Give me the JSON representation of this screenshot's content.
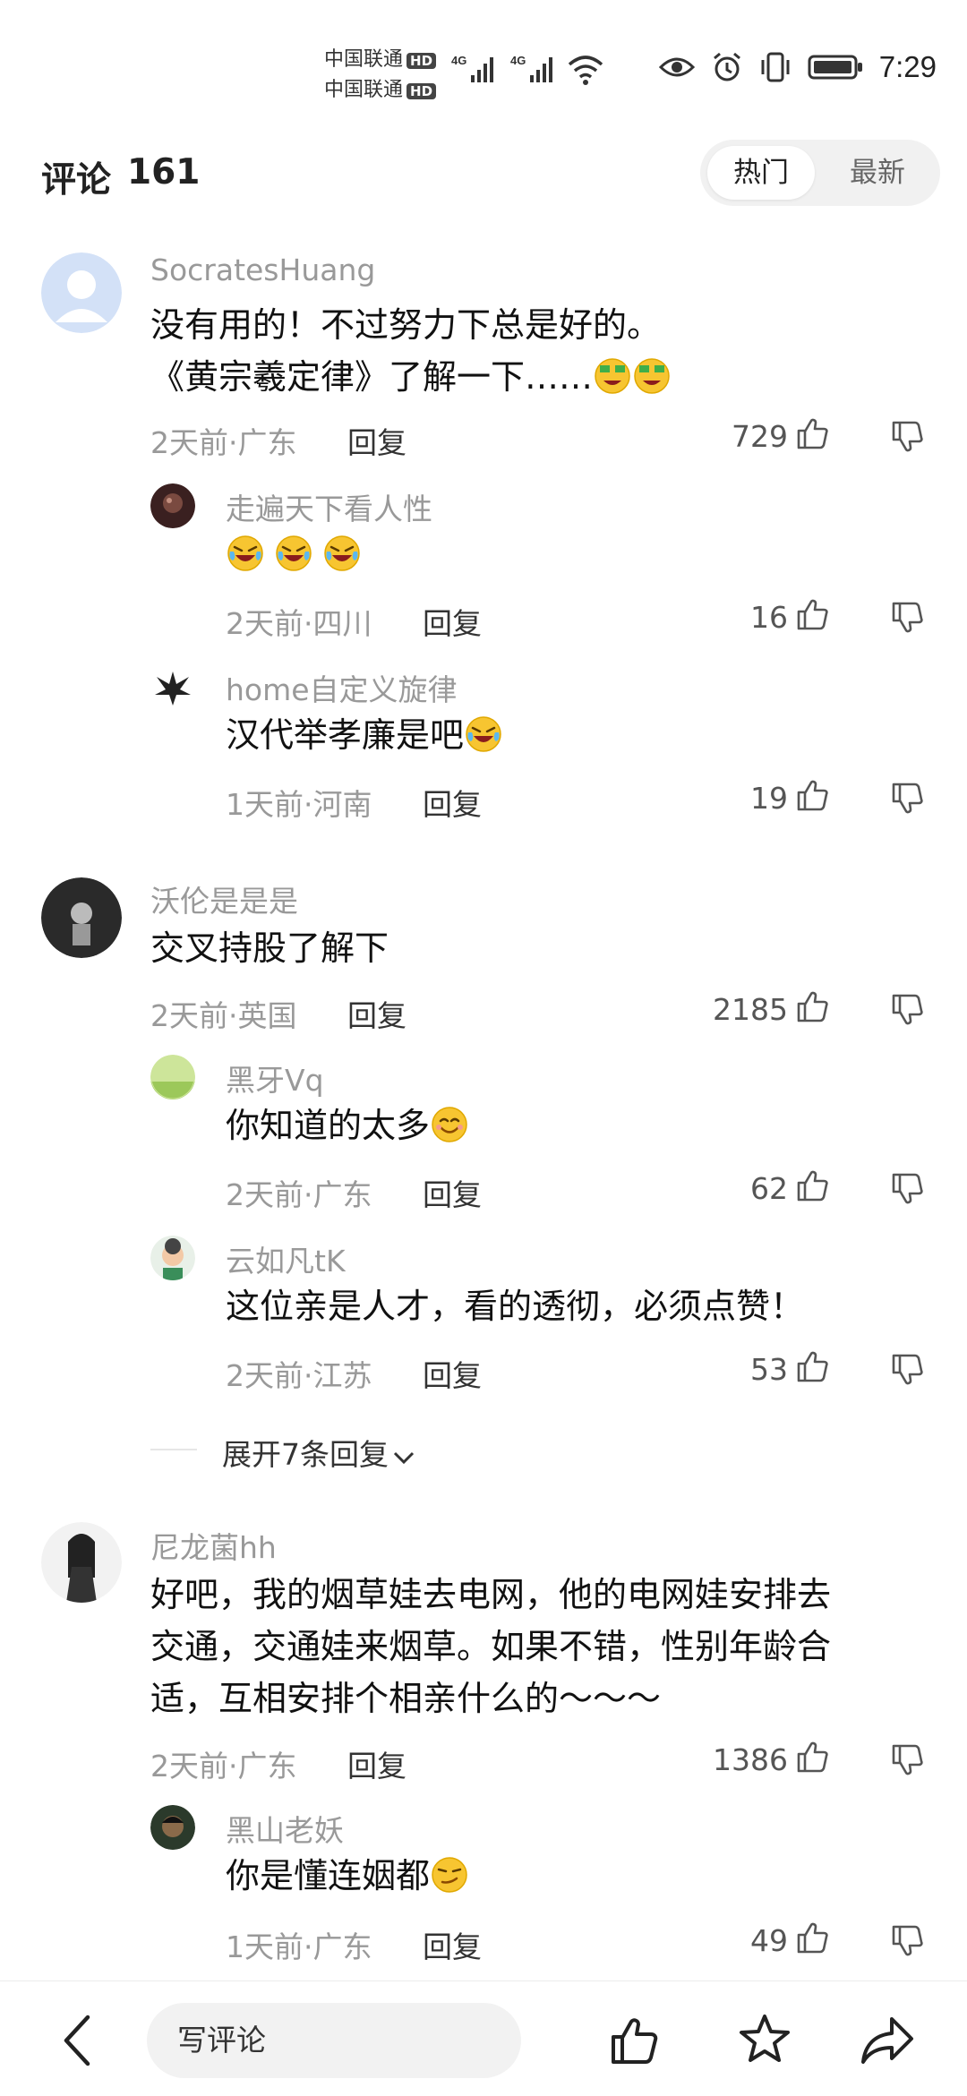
{
  "status_bar": {
    "carrier1": "中国联通",
    "carrier2": "中国联通",
    "hd": "HD",
    "net1": "4G",
    "net2": "4G",
    "time": "7:29"
  },
  "header": {
    "title": "评论",
    "count": "161",
    "tabs": [
      "热门",
      "最新"
    ],
    "active_tab": "热门"
  },
  "comments": [
    {
      "author": "SocratesHuang",
      "text_line1": "没有用的！不过努力下总是好的。",
      "text_line2": "《黄宗羲定律》了解一下……",
      "time_loc": "2天前·广东",
      "reply": "回复",
      "likes": "729",
      "replies": [
        {
          "author": "走遍天下看人性",
          "time_loc": "2天前·四川",
          "reply": "回复",
          "likes": "16"
        },
        {
          "author": "home自定义旋律",
          "text": "汉代举孝廉是吧",
          "time_loc": "1天前·河南",
          "reply": "回复",
          "likes": "19"
        }
      ]
    },
    {
      "author": "沃伦是是是",
      "text": "交叉持股了解下",
      "time_loc": "2天前·英国",
      "reply": "回复",
      "likes": "2185",
      "replies": [
        {
          "author": "黑牙Vq",
          "text": "你知道的太多",
          "time_loc": "2天前·广东",
          "reply": "回复",
          "likes": "62"
        },
        {
          "author": "云如凡tK",
          "text": "这位亲是人才，看的透彻，必须点赞！",
          "time_loc": "2天前·江苏",
          "reply": "回复",
          "likes": "53"
        }
      ],
      "expand": "展开7条回复"
    },
    {
      "author": "尼龙菌hh",
      "text_line1": "好吧，我的烟草娃去电网，他的电网娃安排去",
      "text_line2": "交通，交通娃来烟草。如果不错，性别年龄合",
      "text_line3": "适，互相安排个相亲什么的～～～",
      "time_loc": "2天前·广东",
      "reply": "回复",
      "likes": "1386",
      "replies": [
        {
          "author": "黑山老妖",
          "text": "你是懂连姻都",
          "time_loc": "1天前·广东",
          "reply": "回复",
          "likes": "49"
        }
      ]
    }
  ],
  "bottom_bar": {
    "input_placeholder": "写评论",
    "icons": [
      "back-icon",
      "like-icon",
      "star-icon",
      "share-icon"
    ]
  },
  "colors": {
    "muted": "#999999",
    "text": "#111111",
    "emoji": "#f7c531"
  }
}
